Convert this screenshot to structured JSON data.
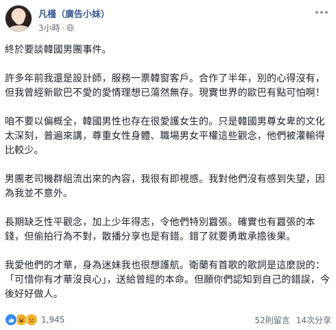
{
  "header": {
    "author": "凡槿（廣告小妹）",
    "time": "3小時",
    "separator": "·"
  },
  "paragraphs": [
    "終於要談韓國男團事件。",
    "許多年前我還是設計師，服務一票韓窗客戶。合作了半年，別的心得沒有，但我曾經新歐巴不愛的愛情理想已蕩然無存。現實世界的歐巴有點可怕啊！",
    "咱不要以偏概全，韓國男性也存在很愛護女生的。只是韓國男尊女卑的文化太深刻，普遍來講，尊重女性身體、職場男女平權這些觀念，他們被灌輸得比較少。",
    "男團老司機群組流出來的內容，我很有即視感。我對他們沒有感到失望，因為我並不意外。",
    "長期缺乏性平觀念，加上少年得志，令他們特別囂張。確實也有囂張的本錢，但偷拍行為不對，散播分享也是有錯。錯了就要勇敢承擔後果。",
    "我愛他們的才華，身為迷妹我也很想護航。衛蘭有首歌的歌詞是這麼說的：「可惜你有才華沒良心」，送給曾經的本命。但願你們認知到自己的錯誤，今後好好做人。"
  ],
  "footer": {
    "reaction_count": "1,945",
    "comments": "52則留言",
    "shares": "14次分享",
    "reaction_icons": [
      "like-icon",
      "haha-icon",
      "sad-icon"
    ]
  },
  "colors": {
    "author": "#365899",
    "text": "#1d2129",
    "meta": "#616770",
    "like": "#2d88ff",
    "emoji": "#f7b125"
  }
}
